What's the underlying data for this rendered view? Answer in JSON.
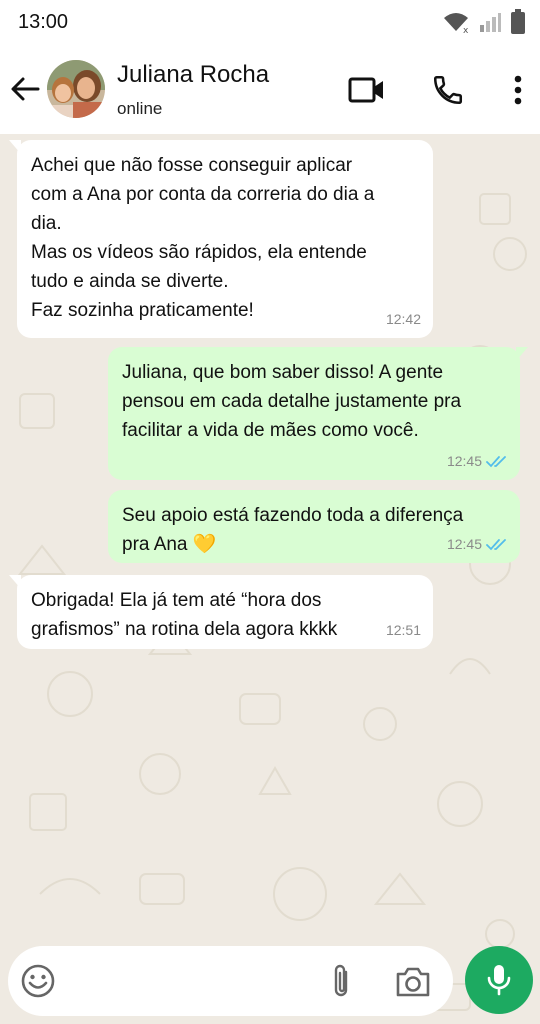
{
  "status_bar": {
    "time": "13:00"
  },
  "header": {
    "contact_name": "Juliana Rocha",
    "contact_status": "online",
    "icons": [
      "arrow-back-icon",
      "videocam-icon",
      "phone-icon",
      "more-vert-icon"
    ]
  },
  "messages": [
    {
      "direction": "in",
      "text": "Achei que não fosse conseguir aplicar\ncom a Ana por conta da correria do dia a\ndia.\nMas os vídeos são rápidos, ela entende\ntudo e ainda se diverte.\nFaz sozinha praticamente!",
      "time": "12:42"
    },
    {
      "direction": "out",
      "text": "Juliana, que bom saber disso! A gente\npensou em cada detalhe justamente pra\nfacilitar a vida de mães como você.",
      "time": "12:45",
      "read": true
    },
    {
      "direction": "out",
      "text": "Seu apoio está fazendo toda a diferença\npra Ana 💛",
      "time": "12:45",
      "read": true
    },
    {
      "direction": "in",
      "text": "Obrigada! Ela já tem até “hora dos\ngrafismos” na rotina dela agora kkkk",
      "time": "12:51"
    }
  ],
  "composer": {
    "placeholder": "",
    "icons": [
      "emoji-icon",
      "attach-icon",
      "camera-icon",
      "mic-icon"
    ]
  },
  "colors": {
    "incoming_bubble": "#ffffff",
    "outgoing_bubble": "#d9fdd3",
    "chat_background": "#efeae2",
    "read_ticks": "#53bdeb",
    "mic_button": "#1daa61"
  }
}
